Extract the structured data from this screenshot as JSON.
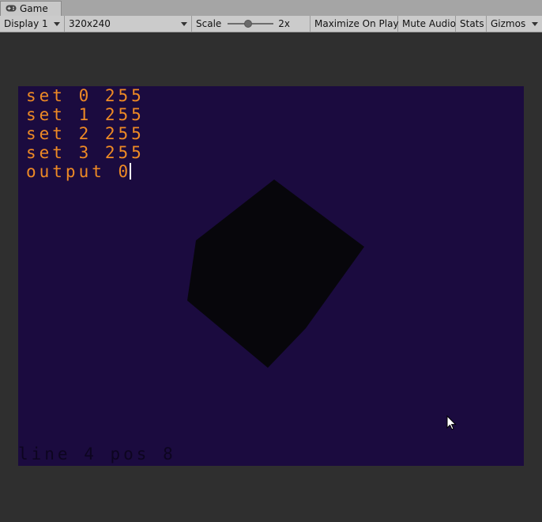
{
  "tab": {
    "label": "Game",
    "icon": "gamepad-icon"
  },
  "toolbar": {
    "display": "Display 1",
    "resolution": "320x240",
    "scale_label": "Scale",
    "scale_value": "2x",
    "scale_level": 0.45,
    "maximize_on_play": "Maximize On Play",
    "mute_audio": "Mute Audio",
    "stats": "Stats",
    "gizmos": "Gizmos"
  },
  "game": {
    "background": "#1b0b3f",
    "text_color": "#ee8a25",
    "console_lines": [
      "set 0 255",
      "set 1 255",
      "set 2 255",
      "set 3 255"
    ],
    "input_line": "output 0",
    "status_line": "line 4 pos 8"
  }
}
